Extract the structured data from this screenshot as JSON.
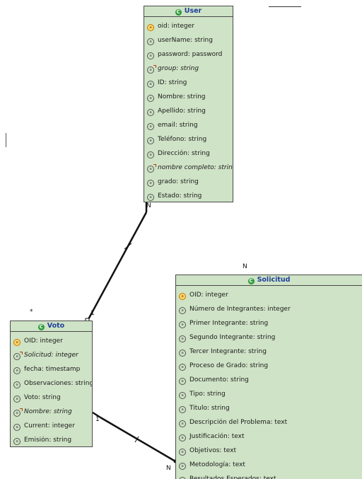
{
  "entities": [
    {
      "key": "user",
      "name": "User",
      "attributes": [
        {
          "text": "oid: integer",
          "icon": "key-attribute-icon",
          "derived": false
        },
        {
          "text": "userName: string",
          "icon": "attribute-icon",
          "derived": false
        },
        {
          "text": "password: password",
          "icon": "attribute-icon",
          "derived": false
        },
        {
          "text": "group: string",
          "icon": "derived-attribute-icon",
          "derived": true
        },
        {
          "text": "ID: string",
          "icon": "attribute-icon",
          "derived": false
        },
        {
          "text": "Nombre: string",
          "icon": "attribute-icon",
          "derived": false
        },
        {
          "text": "Apellido: string",
          "icon": "attribute-icon",
          "derived": false
        },
        {
          "text": "email: string",
          "icon": "attribute-icon",
          "derived": false
        },
        {
          "text": "Teléfono: string",
          "icon": "attribute-icon",
          "derived": false
        },
        {
          "text": "Dirección: string",
          "icon": "attribute-icon",
          "derived": false
        },
        {
          "text": "nombre completo: string",
          "icon": "derived-attribute-icon",
          "derived": true
        },
        {
          "text": "grado: string",
          "icon": "attribute-icon",
          "derived": false
        },
        {
          "text": "Estado: string",
          "icon": "attribute-icon",
          "derived": false
        }
      ]
    },
    {
      "key": "voto",
      "name": "Voto",
      "attributes": [
        {
          "text": "OID: integer",
          "icon": "key-attribute-icon",
          "derived": false
        },
        {
          "text": "Solicitud: integer",
          "icon": "derived-attribute-icon",
          "derived": true
        },
        {
          "text": "fecha: timestamp",
          "icon": "attribute-icon",
          "derived": false
        },
        {
          "text": "Observaciones: string",
          "icon": "attribute-icon",
          "derived": false
        },
        {
          "text": "Voto: string",
          "icon": "attribute-icon",
          "derived": false
        },
        {
          "text": "Nombre: string",
          "icon": "derived-attribute-icon",
          "derived": true
        },
        {
          "text": "Current: integer",
          "icon": "attribute-icon",
          "derived": false
        },
        {
          "text": "Emisión: string",
          "icon": "attribute-icon",
          "derived": false
        }
      ]
    },
    {
      "key": "solicitud",
      "name": "Solicitud",
      "attributes": [
        {
          "text": "OID: integer",
          "icon": "key-attribute-icon",
          "derived": false
        },
        {
          "text": "Número de Integrantes: integer",
          "icon": "attribute-icon",
          "derived": false
        },
        {
          "text": "Primer Integrante: string",
          "icon": "attribute-icon",
          "derived": false
        },
        {
          "text": "Segundo Integrante: string",
          "icon": "attribute-icon",
          "derived": false
        },
        {
          "text": "Tercer Integrante: string",
          "icon": "attribute-icon",
          "derived": false
        },
        {
          "text": "Proceso de Grado: string",
          "icon": "attribute-icon",
          "derived": false
        },
        {
          "text": "Documento: string",
          "icon": "attribute-icon",
          "derived": false
        },
        {
          "text": "Tipo: string",
          "icon": "attribute-icon",
          "derived": false
        },
        {
          "text": "Titulo: string",
          "icon": "attribute-icon",
          "derived": false
        },
        {
          "text": "Descripción del Problema: text",
          "icon": "attribute-icon",
          "derived": false
        },
        {
          "text": "Justificación: text",
          "icon": "attribute-icon",
          "derived": false
        },
        {
          "text": "Objetivos: text",
          "icon": "attribute-icon",
          "derived": false
        },
        {
          "text": "Metodología: text",
          "icon": "attribute-icon",
          "derived": false
        },
        {
          "text": "Resultados Esperados: text",
          "icon": "attribute-icon",
          "derived": false
        }
      ]
    }
  ],
  "relationships": [
    {
      "from": "user",
      "to": "voto",
      "from_card": "N",
      "to_card": "1"
    },
    {
      "from": "voto",
      "to": "solicitud",
      "from_card": "1",
      "to_card": "N"
    }
  ],
  "stray_labels": {
    "voto_top": "*",
    "solicitud_top": "N"
  },
  "colors": {
    "entity_fill": "#cfe3c6",
    "header_text": "#1f3f9a",
    "class_icon": "#2e9a3b",
    "line": "#111111"
  }
}
